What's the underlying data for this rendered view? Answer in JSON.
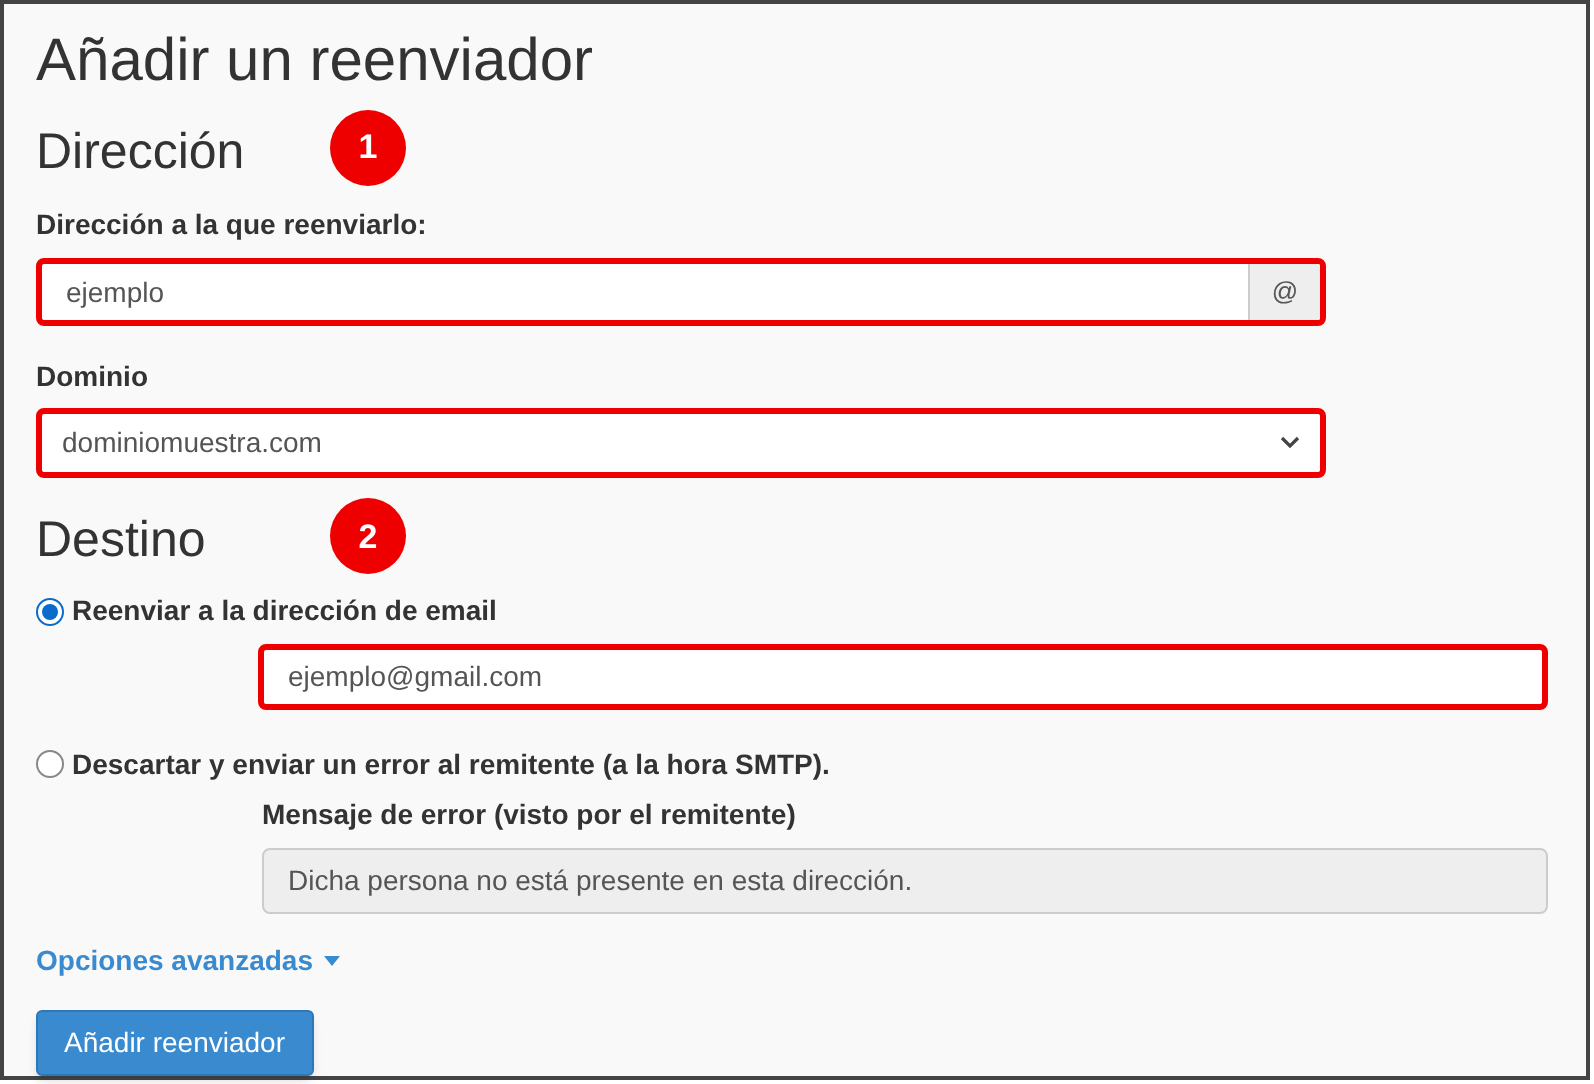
{
  "title": "Añadir un reenviador",
  "address": {
    "heading": "Dirección",
    "badge": "1",
    "forward_field": {
      "label": "Dirección a la que reenviarlo:",
      "value": "ejemplo",
      "addon": "@",
      "highlighted": true
    },
    "domain_field": {
      "label": "Dominio",
      "value": "dominiomuestra.com",
      "highlighted": true
    }
  },
  "destination": {
    "heading": "Destino",
    "badge": "2",
    "options": [
      {
        "kind": "email",
        "label": "Reenviar a la dirección de email",
        "selected": true,
        "value": "ejemplo@gmail.com",
        "highlighted": true
      },
      {
        "kind": "error",
        "label": "Descartar y enviar un error al remitente (a la hora SMTP).",
        "selected": false,
        "field_label": "Mensaje de error (visto por el remitente)",
        "value": "Dicha persona no está presente en esta dirección.",
        "disabled": true
      }
    ]
  },
  "advanced_link": "Opciones avanzadas",
  "submit_button": "Añadir reenviador"
}
